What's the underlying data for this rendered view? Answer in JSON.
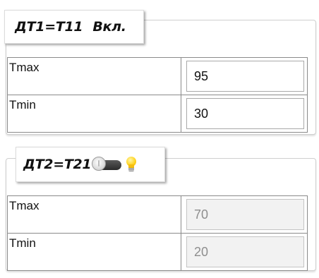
{
  "panels": [
    {
      "title": "ДТ1=Т11",
      "status": "Вкл.",
      "rows": [
        {
          "label": "Tmax",
          "value": "95"
        },
        {
          "label": "Tmin",
          "value": "30"
        }
      ]
    },
    {
      "title": "ДТ2=Т21",
      "toggle_state": "off",
      "icons": [
        "toggle-switch-icon",
        "light-bulb-icon"
      ],
      "rows": [
        {
          "label": "Tmax",
          "value": "70"
        },
        {
          "label": "Tmin",
          "value": "20"
        }
      ]
    }
  ],
  "colors": {
    "bulb": "#ffd21a",
    "disabled_text": "#8e8e8e",
    "disabled_field": "#f2f2f2"
  }
}
